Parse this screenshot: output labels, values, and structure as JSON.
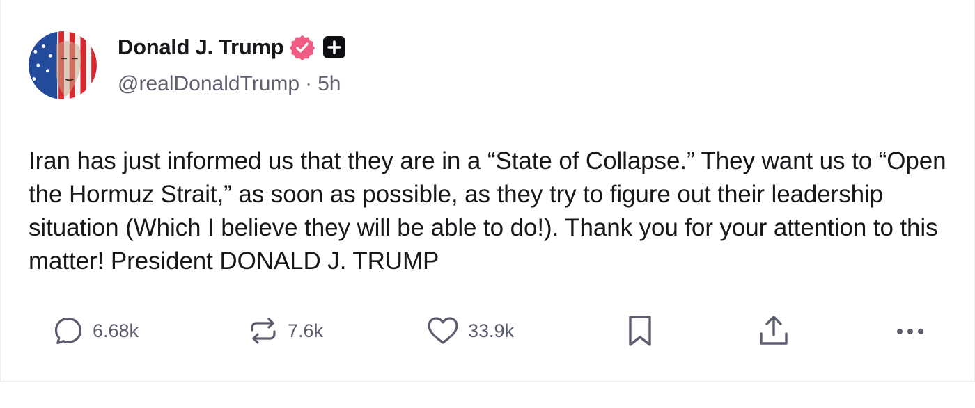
{
  "author": {
    "display_name": "Donald J. Trump",
    "handle": "@realDonaldTrump",
    "separator": "·",
    "timestamp": "5h",
    "verified_icon": "verified-badge-icon",
    "plus_icon": "plus-badge-icon",
    "avatar_icon": "avatar-image"
  },
  "post": {
    "text": "Iran has just informed us that they are in a “State of Collapse.” They want us to “Open the Hormuz Strait,” as soon as possible, as they try to figure out their leadership situation (Which I believe they will be able to do!). Thank you for your attention to this matter! President DONALD J. TRUMP"
  },
  "actions": {
    "reply": {
      "icon": "reply-icon",
      "count": "6.68k"
    },
    "retruth": {
      "icon": "retruth-icon",
      "count": "7.6k"
    },
    "like": {
      "icon": "heart-icon",
      "count": "33.9k"
    },
    "bookmark": {
      "icon": "bookmark-icon"
    },
    "share": {
      "icon": "share-icon"
    },
    "more": {
      "icon": "more-icon"
    }
  },
  "colors": {
    "text_primary": "#17171c",
    "text_secondary": "#606070",
    "icon_gray": "#5b5d6e",
    "verified_pink": "#ef5b82",
    "plus_badge_bg": "#0d0d12"
  }
}
